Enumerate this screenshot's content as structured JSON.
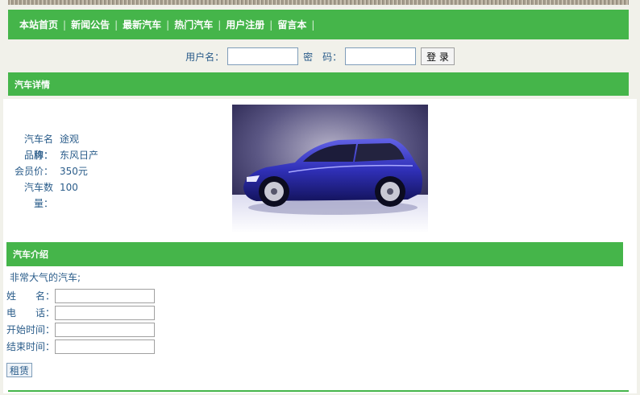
{
  "nav": {
    "items": [
      "本站首页",
      "新闻公告",
      "最新汽车",
      "热门汽车",
      "用户注册",
      "留言本"
    ]
  },
  "login": {
    "username_label": "用户名：",
    "password_label": "密　码：",
    "submit_label": "登 录"
  },
  "detail": {
    "section_title": "汽车详情",
    "rows": [
      {
        "label": "汽车名称：",
        "value": "途观"
      },
      {
        "label": "品牌：",
        "value": "东风日产"
      },
      {
        "label": "会员价：",
        "value": "350元"
      },
      {
        "label": "汽车数量：",
        "value": "100"
      }
    ]
  },
  "intro": {
    "section_title": "汽车介绍",
    "text": "非常大气的汽车;"
  },
  "rental_form": {
    "name_label": "姓　　名：",
    "phone_label": "电　　话：",
    "start_label": "开始时间：",
    "end_label": "结束时间：",
    "submit_label": "租赁"
  },
  "colors": {
    "accent_green": "#45b54a",
    "text_blue": "#2a5c8a"
  }
}
